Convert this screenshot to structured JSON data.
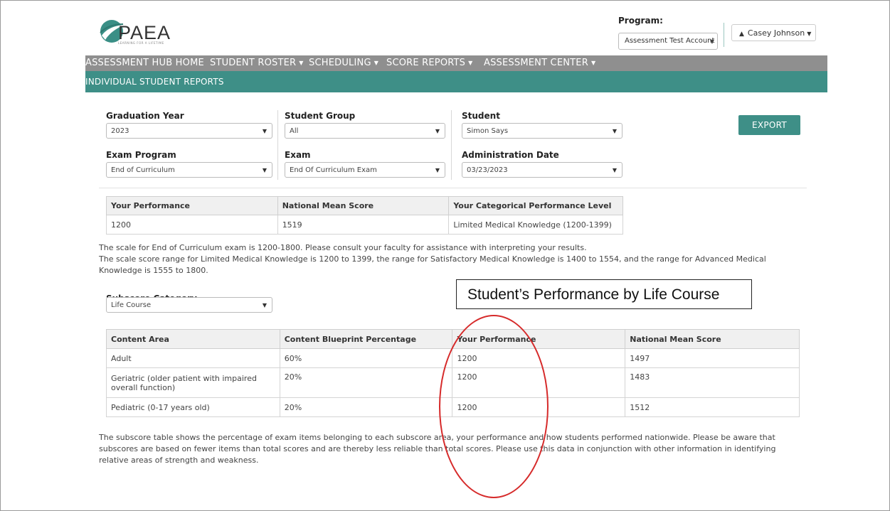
{
  "header": {
    "logo_text": "PAEA",
    "logo_tagline": "LEARNING FOR A LIFETIME",
    "program_label": "Program:",
    "program_value": "Assessment Test Account",
    "user_name": "Casey Johnson"
  },
  "nav": {
    "items": [
      {
        "label": "ASSESSMENT HUB HOME",
        "has_menu": false
      },
      {
        "label": "STUDENT ROSTER",
        "has_menu": true
      },
      {
        "label": "SCHEDULING",
        "has_menu": true
      },
      {
        "label": "SCORE REPORTS",
        "has_menu": true
      },
      {
        "label": "ASSESSMENT CENTER",
        "has_menu": true
      }
    ],
    "sub_title": "INDIVIDUAL STUDENT REPORTS"
  },
  "filters": {
    "graduation_year": {
      "label": "Graduation Year",
      "value": "2023"
    },
    "student_group": {
      "label": "Student Group",
      "value": "All"
    },
    "student": {
      "label": "Student",
      "value": "Simon Says"
    },
    "exam_program": {
      "label": "Exam Program",
      "value": "End of Curriculum"
    },
    "exam": {
      "label": "Exam",
      "value": "End Of Curriculum Exam"
    },
    "administration_date": {
      "label": "Administration Date",
      "value": "03/23/2023"
    }
  },
  "export_label": "EXPORT",
  "performance_table": {
    "headers": [
      "Your Performance",
      "National Mean Score",
      "Your Categorical Performance Level"
    ],
    "row": [
      "1200",
      "1519",
      "Limited Medical Knowledge (1200-1399)"
    ]
  },
  "scale_text_1": "The scale for End of Curriculum exam is 1200-1800. Please consult your faculty for assistance with interpreting your results.",
  "scale_text_2": "The scale score range for Limited Medical Knowledge is 1200 to 1399, the range for Satisfactory Medical Knowledge is 1400 to 1554, and the range for Advanced Medical Knowledge is 1555 to 1800.",
  "subscore": {
    "label": "Subscore Category",
    "value": "Life Course"
  },
  "annotation": "Student’s Performance by Life Course",
  "content_table": {
    "headers": [
      "Content Area",
      "Content Blueprint Percentage",
      "Your Performance",
      "National Mean Score"
    ],
    "rows": [
      [
        "Adult",
        "60%",
        "1200",
        "1497"
      ],
      [
        "Geriatric (older patient with impaired overall function)",
        "20%",
        "1200",
        "1483"
      ],
      [
        "Pediatric (0-17 years old)",
        "20%",
        "1200",
        "1512"
      ]
    ]
  },
  "footer_text": "The subscore table shows the percentage of exam items belonging to each subscore area, your performance and how students performed nationwide. Please be aware that subscores are based on fewer items than total scores and are thereby less reliable than total scores. Please use this data in conjunction with other information in identifying relative areas of strength and weakness.",
  "colors": {
    "teal": "#3e8f87",
    "nav_gray": "#8f8f8f",
    "annotation_red": "#d62a2a"
  }
}
